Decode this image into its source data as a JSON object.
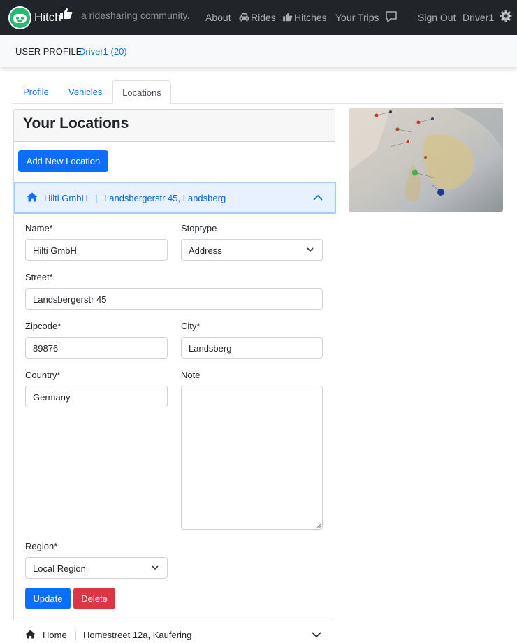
{
  "navbar": {
    "brand": "Hitch",
    "tagline": "a ridesharing community.",
    "links": {
      "about": "About",
      "rides": "Rides",
      "hitches": "Hitches",
      "your_trips": "Your Trips",
      "sign_out": "Sign Out",
      "user": "Driver1"
    }
  },
  "profile": {
    "label": "USER PROFILE",
    "user_link": "Driver1 (20)"
  },
  "tabs": [
    "Profile",
    "Vehicles",
    "Locations"
  ],
  "active_tab": "Locations",
  "locations": {
    "title": "Your Locations",
    "add_button": "Add New Location",
    "expanded": {
      "name": "Hilti GmbH",
      "separator": "|",
      "address": "Landsbergerstr 45, Landsberg",
      "form": {
        "name_label": "Name*",
        "name_value": "Hilti GmbH",
        "stoptype_label": "Stoptype",
        "stoptype_value": "Address",
        "street_label": "Street*",
        "street_value": "Landsbergerstr 45",
        "zipcode_label": "Zipcode*",
        "zipcode_value": "89876",
        "city_label": "City*",
        "city_value": "Landsberg",
        "country_label": "Country*",
        "country_value": "Germany",
        "note_label": "Note",
        "note_value": "",
        "region_label": "Region*",
        "region_value": "Local Region",
        "update_button": "Update",
        "delete_button": "Delete"
      }
    },
    "collapsed": {
      "name": "Home",
      "separator": "|",
      "address": "Homestreet 12a, Kaufering"
    }
  },
  "colors": {
    "navbar": "#212529",
    "accent": "#0d6efd",
    "danger": "#dc3545",
    "logo": "#2bb673"
  }
}
